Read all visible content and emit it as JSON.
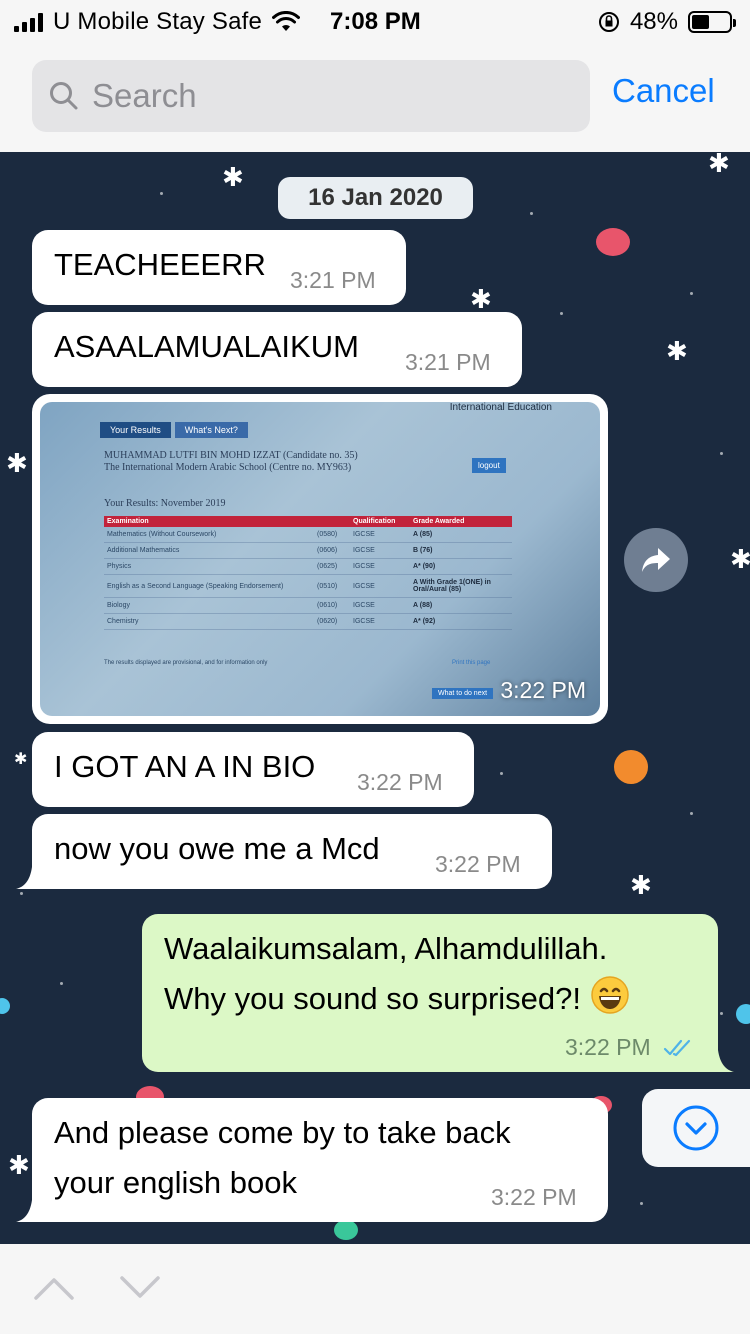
{
  "status_bar": {
    "carrier": "U Mobile Stay Safe",
    "time": "7:08 PM",
    "battery_pct": "48%",
    "battery_level": 0.48,
    "icons": [
      "signal-bars-icon",
      "wifi-icon",
      "orientation-lock-icon",
      "battery-icon"
    ]
  },
  "search": {
    "placeholder": "Search",
    "value": "",
    "cancel_label": "Cancel"
  },
  "chat": {
    "date_label": "16 Jan 2020",
    "messages": [
      {
        "id": "m1",
        "direction": "in",
        "text": "TEACHEEERR",
        "time": "3:21 PM"
      },
      {
        "id": "m2",
        "direction": "in",
        "text": "ASAALAMUALAIKUM",
        "time": "3:21 PM"
      },
      {
        "id": "m3",
        "direction": "in",
        "type": "image",
        "time": "3:22 PM"
      },
      {
        "id": "m4",
        "direction": "in",
        "text": "I GOT AN A IN BIO",
        "time": "3:22 PM"
      },
      {
        "id": "m5",
        "direction": "in",
        "text": "now you owe me a Mcd",
        "time": "3:22 PM"
      },
      {
        "id": "m6",
        "direction": "out",
        "lines": [
          "Waalaikumsalam, Alhamdulillah.",
          "Why you sound so surprised?!"
        ],
        "emoji": "grinning-face-icon",
        "time": "3:22 PM",
        "status": "read"
      },
      {
        "id": "m7",
        "direction": "in",
        "lines": [
          "And please come by to take back",
          "your english book"
        ],
        "time": "3:22 PM"
      }
    ]
  },
  "result_image": {
    "header": "International Education",
    "tabs": [
      "Your Results",
      "What's Next?"
    ],
    "name_line": "MUHAMMAD LUTFI BIN MOHD IZZAT  (Candidate no. 35)",
    "school_line": "The International Modern Arabic School (Centre no. MY963)",
    "logout_label": "logout",
    "results_title": "Your Results: November 2019",
    "columns": [
      "Examination",
      "",
      "Qualification",
      "Grade Awarded"
    ],
    "rows": [
      {
        "exam": "Mathematics (Without Coursework)",
        "code": "(0580)",
        "qual": "IGCSE",
        "grade": "A (85)"
      },
      {
        "exam": "Additional Mathematics",
        "code": "(0606)",
        "qual": "IGCSE",
        "grade": "B (76)"
      },
      {
        "exam": "Physics",
        "code": "(0625)",
        "qual": "IGCSE",
        "grade": "A* (90)"
      },
      {
        "exam": "English as a Second Language (Speaking Endorsement)",
        "code": "(0510)",
        "qual": "IGCSE",
        "grade": "A With Grade 1(ONE) in Oral/Aural (85)"
      },
      {
        "exam": "Biology",
        "code": "(0610)",
        "qual": "IGCSE",
        "grade": "A (88)"
      },
      {
        "exam": "Chemistry",
        "code": "(0620)",
        "qual": "IGCSE",
        "grade": "A* (92)"
      }
    ],
    "footnote": "The results displayed are provisional, and for information only",
    "print_label": "Print this page",
    "what_next_label": "What to do next"
  },
  "colors": {
    "chat_bg": "#1b2a3f",
    "incoming_bubble": "#ffffff",
    "outgoing_bubble": "#dcf8c6",
    "accent_blue": "#0a7cff",
    "read_ticks": "#4fb3e8"
  },
  "controls": {
    "forward_icon": "forward-arrow-icon",
    "scroll_icon": "chevron-down-circle-icon",
    "nav_up_icon": "chevron-up-icon",
    "nav_down_icon": "chevron-down-icon"
  }
}
